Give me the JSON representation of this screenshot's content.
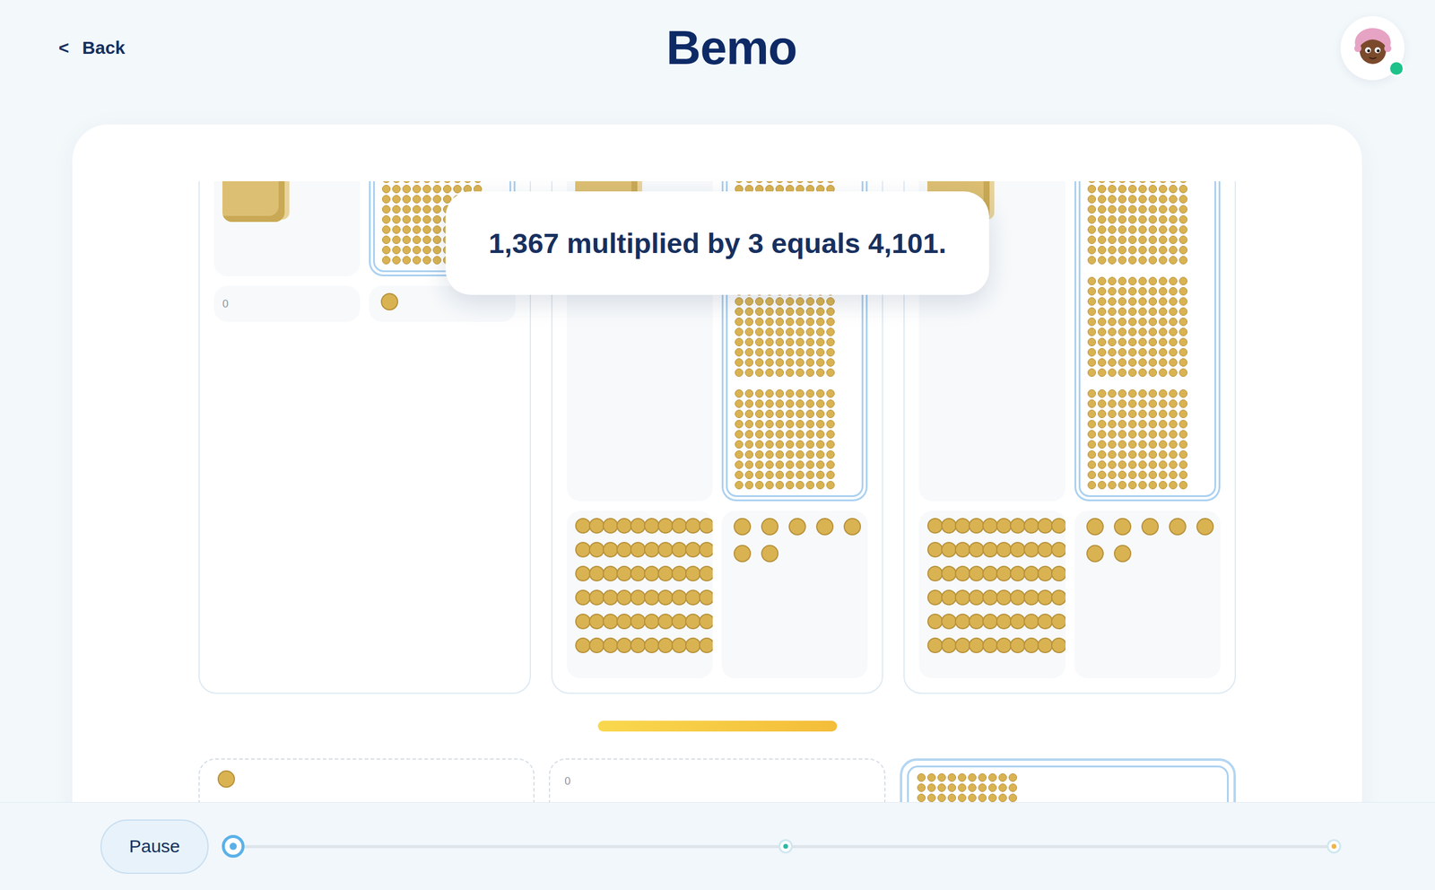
{
  "header": {
    "back_icon": "<",
    "back_label": "Back",
    "title": "Bemo",
    "avatar": {
      "online": true
    }
  },
  "tooltip": {
    "text": "1,367 multiplied by 3 equals 4,101."
  },
  "boards": [
    {
      "thousands": {
        "count": 1
      },
      "hundreds": {
        "count": 1,
        "selected": true
      },
      "tens": {
        "count": 0,
        "label": "0"
      },
      "ones": {
        "count": 1
      }
    },
    {
      "thousands": {
        "count": 1
      },
      "hundreds": {
        "count": 3,
        "selected": true
      },
      "tens": {
        "count": 6
      },
      "ones": {
        "count": 7
      }
    },
    {
      "thousands": {
        "count": 1
      },
      "hundreds": {
        "count": 3,
        "selected": true
      },
      "tens": {
        "count": 6
      },
      "ones": {
        "count": 7
      }
    }
  ],
  "result": [
    {
      "place": "ones",
      "count": 1,
      "selected": false
    },
    {
      "place": "tens",
      "count": 0,
      "label": "0",
      "selected": false
    },
    {
      "place": "hundreds",
      "count": 1,
      "selected": true
    }
  ],
  "footer": {
    "button": "Pause",
    "progress": {
      "level": 0,
      "markers": [
        {
          "selected": true,
          "color": "#5ab1e8"
        },
        {
          "selected": false,
          "color": "#2fb8a6"
        },
        {
          "selected": false,
          "color": "#f5b342"
        }
      ]
    }
  }
}
